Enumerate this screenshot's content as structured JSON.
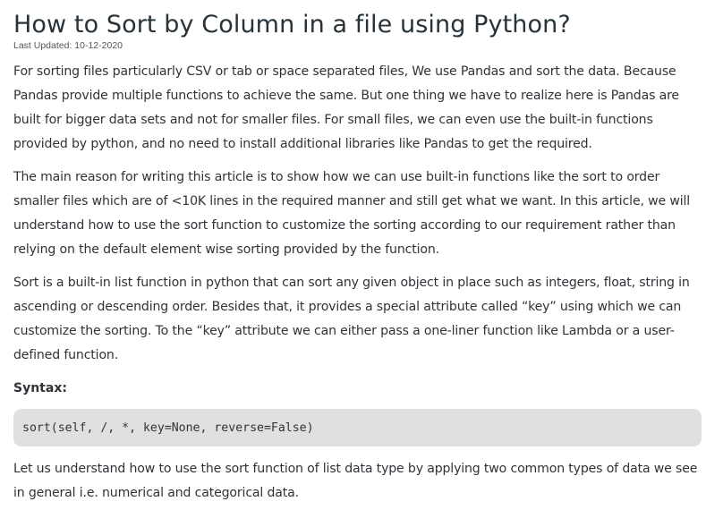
{
  "article": {
    "title": "How to Sort by Column in a file using Python?",
    "last_updated": "Last Updated: 10-12-2020",
    "paragraphs": [
      "For sorting files particularly CSV or tab or space separated files, We use Pandas and sort the data. Because Pandas provide multiple functions to achieve the same. But one thing we have to realize here is Pandas are built for bigger data sets and not for smaller files. For small files, we can even use the built-in functions provided by python, and no need to install additional libraries like Pandas to get the required.",
      "The main reason for writing this article is to show how we can use built-in functions like the sort to order smaller files which are of <10K lines in the required manner and still get what we want. In this article, we will understand how to use the sort function to customize the sorting according to our requirement rather than relying on the default element wise sorting provided by the function.",
      "Sort is a built-in list function in python that can sort any given object in place such as integers, float, string in ascending or descending order. Besides that, it provides a special attribute called “key” using which we can customize the sorting. To the “key” attribute we can either pass a one-liner function like Lambda or a user-defined function."
    ],
    "syntax_heading": "Syntax:",
    "syntax_code": "sort(self, /, *, key=None, reverse=False)",
    "closing_paragraph": "Let us understand how to use the sort function of list data type by applying two common types of data we see in general i.e. numerical and categorical data."
  }
}
